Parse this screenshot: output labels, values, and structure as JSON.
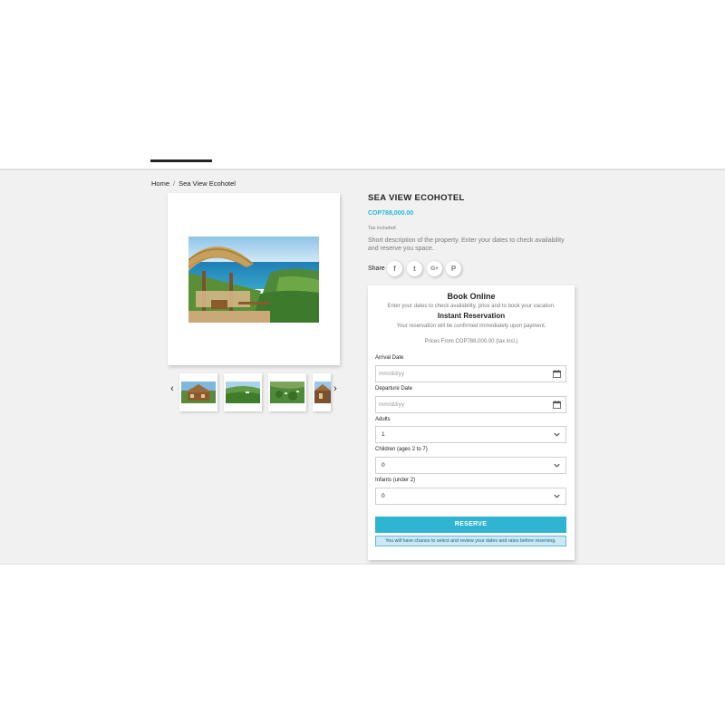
{
  "breadcrumb": {
    "home": "Home",
    "separator": "/",
    "current": "Sea View Ecohotel"
  },
  "product": {
    "title": "SEA VIEW ECOHOTEL",
    "price": "COP788,000.00",
    "tax_label": "Tax included",
    "description": "Short description of the property. Enter your dates to check availability and reserve you space."
  },
  "gallery": {
    "prev_icon": "chevron-left-icon",
    "next_icon": "chevron-right-icon",
    "thumbnail_count": 4
  },
  "share": {
    "label": "Share",
    "buttons": [
      {
        "name": "facebook-icon",
        "glyph": "f"
      },
      {
        "name": "twitter-icon",
        "glyph": "t"
      },
      {
        "name": "google-plus-icon",
        "glyph": "G+"
      },
      {
        "name": "pinterest-icon",
        "glyph": "P"
      }
    ]
  },
  "booking": {
    "title": "Book Online",
    "subtitle": "Enter your dates to check availability, price and to book your vacation.",
    "instant_title": "Instant Reservation",
    "instant_sub": "Your reservation will be confirmed immediately upon payment.",
    "prices_from": "Prices From COP788,000.00 (tax incl.)",
    "arrival_label": "Arrival Date",
    "arrival_placeholder": "mm/dd/yy",
    "departure_label": "Departure Date",
    "departure_placeholder": "mm/dd/yy",
    "adults_label": "Adults",
    "adults_value": "1",
    "children_label": "Children (ages 2 to 7)",
    "children_value": "0",
    "infants_label": "Infants (under 2)",
    "infants_value": "0",
    "reserve_label": "RESERVE",
    "reserve_note": "You will have chance to select and review your dates and rates before reserving."
  },
  "colors": {
    "accent": "#2fb5d2",
    "price": "#24b9d7",
    "text": "#232323",
    "muted": "#7a7a7a",
    "background": "#f1f1f1"
  }
}
